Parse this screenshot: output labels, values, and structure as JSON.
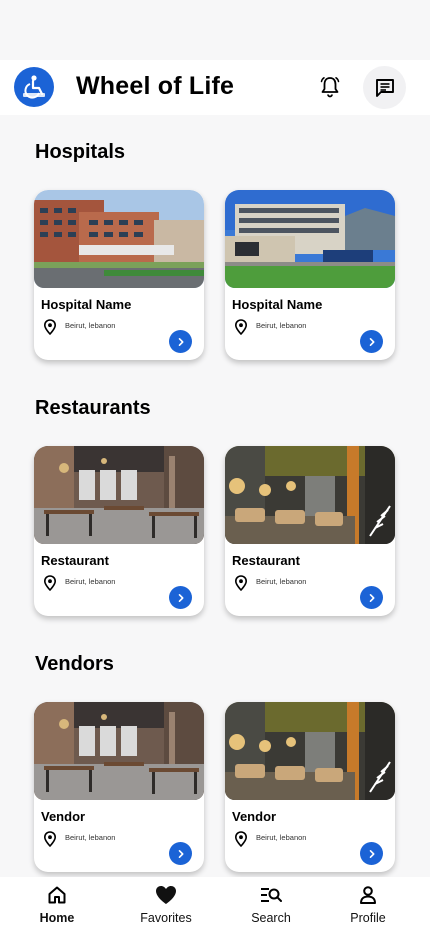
{
  "app": {
    "title": "Wheel of Life"
  },
  "icons": {
    "logo": "wheelchair-logo-icon",
    "bell": "bell-icon",
    "chat": "chat-icon",
    "pin": "location-pin-icon",
    "arrow": "chevron-right-icon"
  },
  "colors": {
    "accent": "#1b63d6",
    "background": "#f7f7f8"
  },
  "sections": [
    {
      "title": "Hospitals",
      "cards": [
        {
          "name": "Hospital Name",
          "location": "Beirut, lebanon"
        },
        {
          "name": "Hospital Name",
          "location": "Beirut, lebanon"
        }
      ]
    },
    {
      "title": "Restaurants",
      "cards": [
        {
          "name": "Restaurant",
          "location": "Beirut, lebanon"
        },
        {
          "name": "Restaurant",
          "location": "Beirut, lebanon"
        }
      ]
    },
    {
      "title": "Vendors",
      "cards": [
        {
          "name": "Vendor",
          "location": "Beirut, lebanon"
        },
        {
          "name": "Vendor",
          "location": "Beirut, lebanon"
        }
      ]
    }
  ],
  "tabbar": {
    "active": "Home",
    "items": [
      {
        "label": "Home",
        "icon": "home-icon"
      },
      {
        "label": "Favorites",
        "icon": "heart-icon"
      },
      {
        "label": "Search",
        "icon": "search-list-icon"
      },
      {
        "label": "Profile",
        "icon": "person-icon"
      }
    ]
  }
}
